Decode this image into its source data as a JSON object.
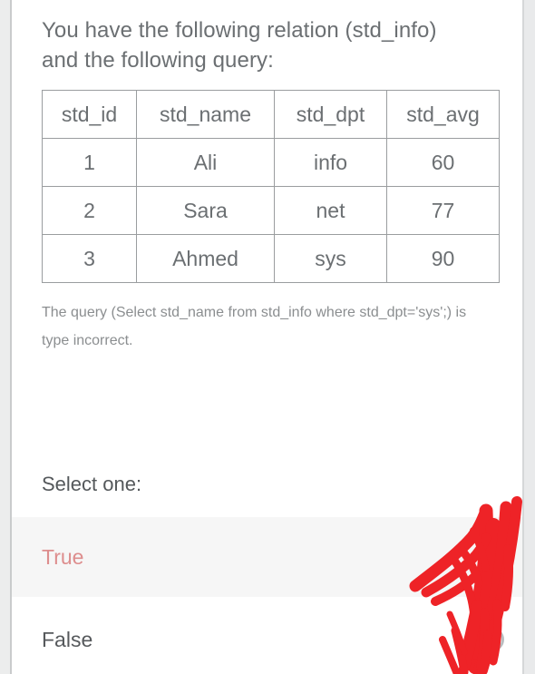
{
  "question": {
    "prompt": "You have the following relation (std_info) and the following query:",
    "note": "The query (Select std_name from std_info where std_dpt='sys';) is type incorrect.",
    "select_instruction": "Select one:"
  },
  "relation_table": {
    "name": "std_info",
    "headers": [
      "std_id",
      "std_name",
      "std_dpt",
      "std_avg"
    ],
    "rows": [
      [
        "1",
        "Ali",
        "info",
        "60"
      ],
      [
        "2",
        "Sara",
        "net",
        "77"
      ],
      [
        "3",
        "Ahmed",
        "sys",
        "90"
      ]
    ]
  },
  "options": [
    {
      "label": "True",
      "selected": true,
      "highlighted": true
    },
    {
      "label": "False",
      "selected": false,
      "highlighted": false
    }
  ],
  "annotation": {
    "type": "hand-drawn-marker-scribble",
    "color": "#ee2327"
  },
  "colors": {
    "prompt_text": "#6b6f72",
    "note_text": "#8b8e90",
    "table_border": "#9a9d9f",
    "option_true_text": "#dd8d8d",
    "option_false_text": "#56595c",
    "highlight_row": "#f6f6f6",
    "gutter": "#eceded",
    "marker_red": "#ee2327"
  }
}
